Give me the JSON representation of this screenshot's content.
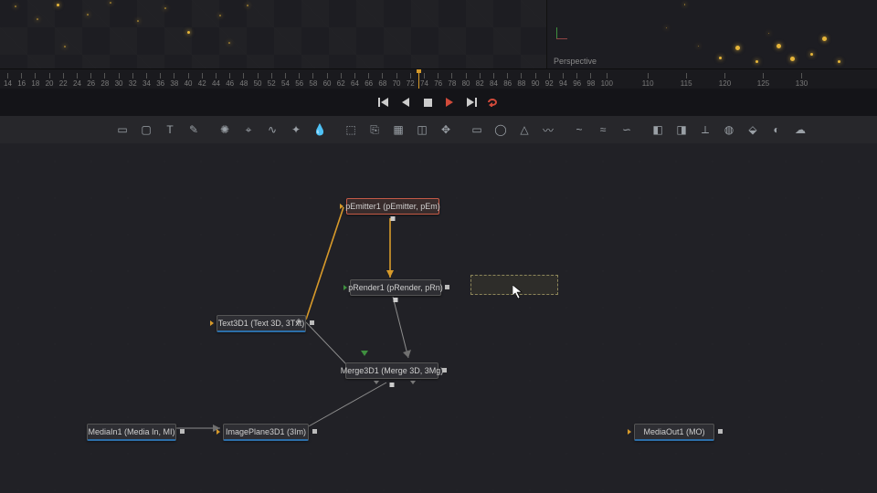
{
  "viewer": {
    "perspective_label": "Perspective"
  },
  "timeline": {
    "start": 14,
    "end": 100,
    "step": 2,
    "current_frame": 73,
    "extra_marks": [
      100,
      110,
      115,
      120,
      125,
      130
    ]
  },
  "transport": {
    "first": "⏮",
    "prev": "◀",
    "stop": "■",
    "play": "▶",
    "last": "⏭",
    "loop": "↻"
  },
  "toolbar_groups": [
    [
      "rectangle",
      "mask-rect",
      "text",
      "brush"
    ],
    [
      "wand",
      "tracker",
      "path",
      "glow",
      "drop"
    ],
    [
      "media-in",
      "media-out",
      "background",
      "merge",
      "transform"
    ],
    [
      "rect-marquee",
      "ellipse",
      "polyline",
      "bspline"
    ],
    [
      "warp-a",
      "warp-b",
      "warp-c"
    ],
    [
      "color-a",
      "color-b",
      "3d-a",
      "3d-b",
      "3d-c",
      "fade",
      "cloud"
    ]
  ],
  "nodes": {
    "pEmitter1": {
      "label": "pEmitter1  (pEmitter, pEm)"
    },
    "pRender1": {
      "label": "pRender1  (pRender, pRn)"
    },
    "Text3D1": {
      "label": "Text3D1  (Text 3D, 3Txt)"
    },
    "Merge3D1": {
      "label": "Merge3D1  (Merge 3D, 3Mg)"
    },
    "MediaIn1": {
      "label": "MediaIn1  (Media In, MI)"
    },
    "ImagePlane3D1": {
      "label": "ImagePlane3D1  (3Im)"
    },
    "MediaOut1": {
      "label": "MediaOut1  (MO)"
    }
  }
}
